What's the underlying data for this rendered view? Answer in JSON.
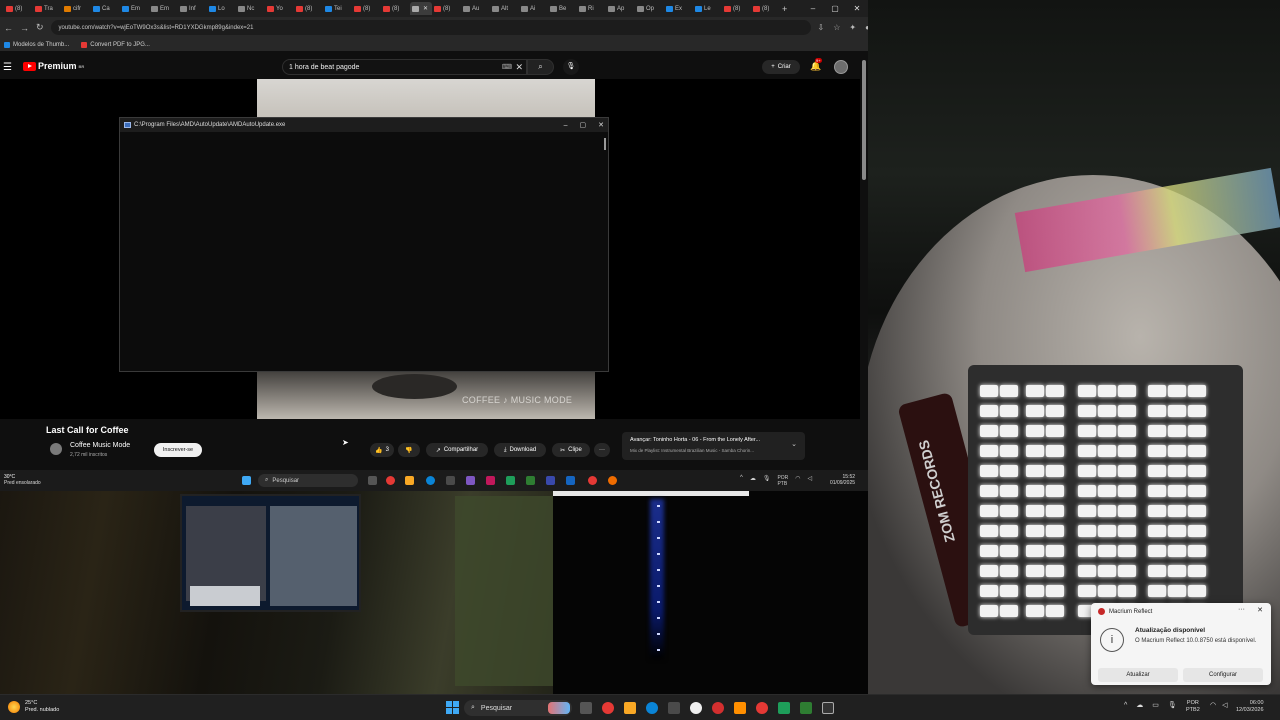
{
  "browser": {
    "tabs": [
      {
        "label": "(8)",
        "color": "#e53935"
      },
      {
        "label": "Tra",
        "color": "#e53935"
      },
      {
        "label": "cifr",
        "color": "#e07b00"
      },
      {
        "label": "Ca",
        "color": "#1e88e5"
      },
      {
        "label": "Em",
        "color": "#1e88e5"
      },
      {
        "label": "Em",
        "color": "#888888"
      },
      {
        "label": "Inf",
        "color": "#888888"
      },
      {
        "label": "Lo",
        "color": "#1e88e5"
      },
      {
        "label": "Nc",
        "color": "#888888"
      },
      {
        "label": "Yo",
        "color": "#e53935"
      },
      {
        "label": "(8)",
        "color": "#e53935"
      },
      {
        "label": "Tei",
        "color": "#1e88e5"
      },
      {
        "label": "(8)",
        "color": "#e53935"
      },
      {
        "label": "(8)",
        "color": "#e53935"
      },
      {
        "label": "",
        "color": "#aaaaaa",
        "active": true
      },
      {
        "label": "(8)",
        "color": "#e53935"
      },
      {
        "label": "Au",
        "color": "#888888"
      },
      {
        "label": "Alt",
        "color": "#888888"
      },
      {
        "label": "Ai",
        "color": "#888888"
      },
      {
        "label": "Be",
        "color": "#888888"
      },
      {
        "label": "Ri",
        "color": "#888888"
      },
      {
        "label": "Ap",
        "color": "#888888"
      },
      {
        "label": "Op",
        "color": "#888888"
      },
      {
        "label": "Ex",
        "color": "#1e88e5"
      },
      {
        "label": "Le",
        "color": "#1e88e5"
      },
      {
        "label": "(8)",
        "color": "#e53935"
      },
      {
        "label": "(8)",
        "color": "#e53935"
      }
    ],
    "url": "youtube.com/watch?v=wjEoTW9Ox3s&list=RD1YXDGkmp89g&index=21",
    "bookmarks": [
      {
        "label": "Modelos de Thumb...",
        "color": "#1e88e5"
      },
      {
        "label": "Convert PDF to JPG...",
        "color": "#e53935"
      }
    ]
  },
  "youtube": {
    "logo_text": "Premium",
    "logo_sup": "BR",
    "search_value": "1 hora de beat pagode",
    "create_label": "Criar",
    "notif_badge": "9+",
    "video_title": "Last Call for Coffee",
    "watermark": "COFFEE ♪ MUSIC MODE",
    "channel_name": "Coffee Music Mode",
    "channel_subs": "2,72 mil inscritos",
    "subscribe_label": "Inscrever-se",
    "like_count": "3",
    "share_label": "Compartilhar",
    "download_label": "Download",
    "clip_label": "Clipe",
    "more_label": "···",
    "upnext_title": "Avançar: Toninho Horta - 06 - From the Lonely After...",
    "upnext_sub": "Mix de Playlist: Instrumental Brazilian Music - Samba Chorin..."
  },
  "console": {
    "title": "C:\\Program Files\\AMD\\AutoUpdate\\AMDAutoUpdate.exe"
  },
  "inner_taskbar": {
    "weather_temp": "30°C",
    "weather_desc": "Pred ensolarado",
    "search_label": "Pesquisar",
    "lang1": "POR",
    "lang2": "PTB",
    "time": "15:52",
    "date": "01/09/2025"
  },
  "webcam": {
    "case_label": "ZOM RECORDS"
  },
  "toast": {
    "app": "Macrium Reflect",
    "title": "Atualização disponível",
    "body": "O Macrium Reflect 10.0.8750 está disponível.",
    "btn_update": "Atualizar",
    "btn_config": "Configurar"
  },
  "taskbar": {
    "weather_temp": "25°C",
    "weather_desc": "Pred. nublado",
    "search_label": "Pesquisar",
    "lang1": "POR",
    "lang2": "PTB2",
    "time": "06:00",
    "date": "12/03/2026"
  }
}
